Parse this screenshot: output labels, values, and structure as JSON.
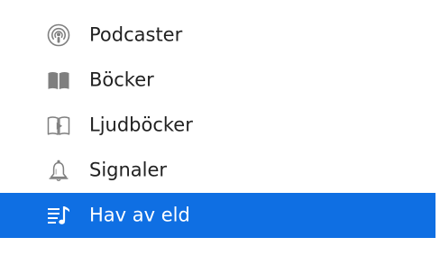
{
  "sidebar": {
    "items": [
      {
        "label": "Podcaster",
        "icon": "podcast-icon",
        "selected": false
      },
      {
        "label": "Böcker",
        "icon": "books-icon",
        "selected": false
      },
      {
        "label": "Ljudböcker",
        "icon": "audiobook-icon",
        "selected": false
      },
      {
        "label": "Signaler",
        "icon": "bell-icon",
        "selected": false
      },
      {
        "label": "Hav av eld",
        "icon": "playlist-icon",
        "selected": true
      }
    ]
  },
  "colors": {
    "selected_background": "#0f6fe3",
    "icon_gray": "#7f7f7f",
    "text": "#222222",
    "selected_text": "#ffffff"
  }
}
